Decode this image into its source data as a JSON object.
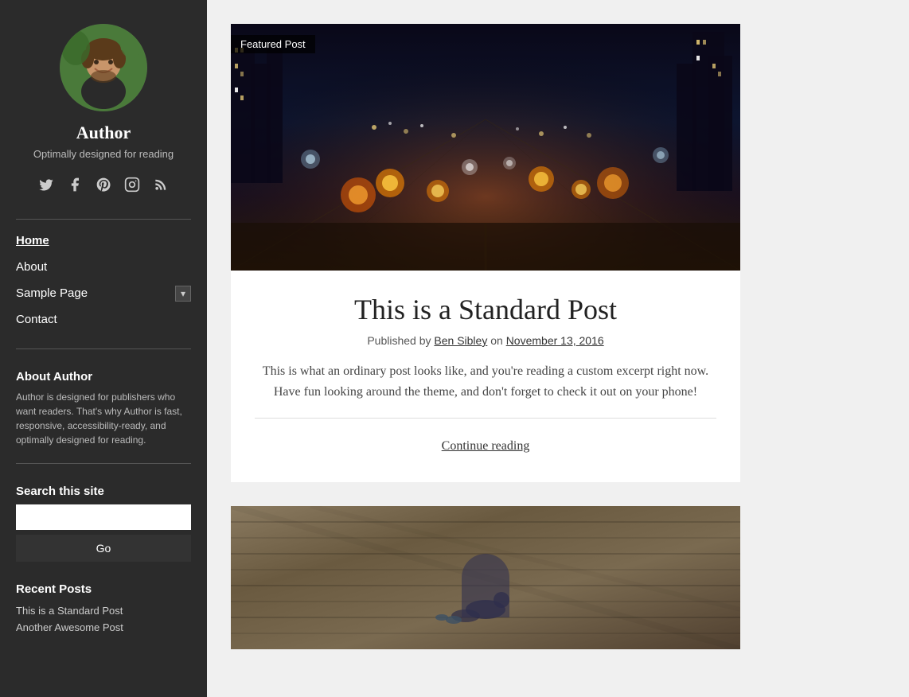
{
  "sidebar": {
    "author_name": "Author",
    "author_tagline": "Optimally designed for reading",
    "social_icons": [
      "𝕏",
      "f",
      "P",
      "◎",
      "⊕"
    ],
    "nav": [
      {
        "label": "Home",
        "active": true,
        "has_dropdown": false
      },
      {
        "label": "About",
        "active": false,
        "has_dropdown": false
      },
      {
        "label": "Sample Page",
        "active": false,
        "has_dropdown": true
      },
      {
        "label": "Contact",
        "active": false,
        "has_dropdown": false
      }
    ],
    "about_section_title": "About Author",
    "about_text": "Author is designed for publishers who want readers. That's why Author is fast, responsive, accessibility-ready, and optimally designed for reading.",
    "search_label": "Search this site",
    "search_placeholder": "",
    "search_button_label": "Go",
    "recent_posts_title": "Recent Posts",
    "recent_posts": [
      {
        "label": "This is a Standard Post"
      },
      {
        "label": "Another Awesome Post"
      }
    ]
  },
  "main": {
    "post1": {
      "featured_badge": "Featured Post",
      "title": "This is a Standard Post",
      "meta_prefix": "Published by ",
      "author_link": "Ben Sibley",
      "meta_on": " on ",
      "date_link": "November 13, 2016",
      "excerpt": "This is what an ordinary post looks like, and you're reading a custom excerpt right now. Have fun looking around the theme, and don't forget to check it out on your phone!",
      "continue_reading": "Continue reading"
    }
  }
}
